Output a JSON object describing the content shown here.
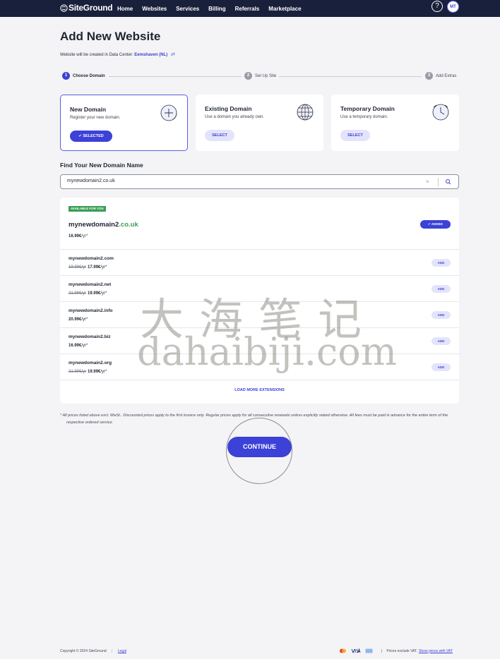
{
  "brand": {
    "name": "SiteGround"
  },
  "nav": {
    "items": [
      {
        "label": "Home"
      },
      {
        "label": "Websites"
      },
      {
        "label": "Services"
      },
      {
        "label": "Billing"
      },
      {
        "label": "Referrals"
      },
      {
        "label": "Marketplace"
      }
    ],
    "help": "?",
    "avatar": "MT"
  },
  "page": {
    "title": "Add New Website",
    "dc_prefix": "Website will be created in Data Center:",
    "dc_name": "Eemshaven (NL)"
  },
  "stepper": [
    {
      "num": "1",
      "label": "Choose Domain"
    },
    {
      "num": "2",
      "label": "Set Up Site"
    },
    {
      "num": "3",
      "label": "Add Extras"
    }
  ],
  "cards": [
    {
      "title": "New Domain",
      "desc": "Register your new domain.",
      "button": "SELECTED",
      "icon": "plus-circle-icon"
    },
    {
      "title": "Existing Domain",
      "desc": "Use a domain you already own.",
      "button": "SELECT",
      "icon": "globe-icon"
    },
    {
      "title": "Temporary Domain",
      "desc": "Use a temporary domain.",
      "button": "SELECT",
      "icon": "clock-globe-icon"
    }
  ],
  "search": {
    "section_title": "Find Your New Domain Name",
    "value": "mynewdomain2.co.uk",
    "clear": "×"
  },
  "featured": {
    "badge": "AVAILABLE FOR YOU",
    "name_base": "mynewdomain2",
    "name_tld": ".co.uk",
    "price": "16.99€",
    "unit": "/yr*",
    "button": "ADDED"
  },
  "domains": [
    {
      "name": "mynewdomain2.com",
      "old": "19.99€/yr",
      "price": "17.99€",
      "unit": "/yr*",
      "button": "ADD"
    },
    {
      "name": "mynewdomain2.net",
      "old": "21.99€/yr",
      "price": "19.99€",
      "unit": "/yr*",
      "button": "ADD"
    },
    {
      "name": "mynewdomain2.info",
      "old": "",
      "price": "20.99€",
      "unit": "/yr*",
      "button": "ADD"
    },
    {
      "name": "mynewdomain2.biz",
      "old": "",
      "price": "16.99€",
      "unit": "/yr*",
      "button": "ADD"
    },
    {
      "name": "mynewdomain2.org",
      "old": "21.99€/yr",
      "price": "19.99€",
      "unit": "/yr*",
      "button": "ADD"
    }
  ],
  "load_more": "LOAD MORE EXTENSIONS",
  "disclaimer": "* All prices listed above excl. MwSt.. Discounted prices apply to the first invoice only. Regular prices apply for all consecutive renewals unless explicitly stated otherwise. All fees must be paid in advance for the entire term of the respective ordered service.",
  "continue": "CONTINUE",
  "watermark": {
    "cn": "大海笔记",
    "en": "dahaibiji.com"
  },
  "footer": {
    "copyright": "Copyright © 2024 SiteGround",
    "separator": "|",
    "legal": "Legal",
    "prices_note": "Prices exclude VAT.",
    "vat_link": "Show prices with VAT"
  },
  "colors": {
    "accent": "#3c41d8",
    "nav_bg": "#18203b",
    "success": "#3a9e55"
  }
}
